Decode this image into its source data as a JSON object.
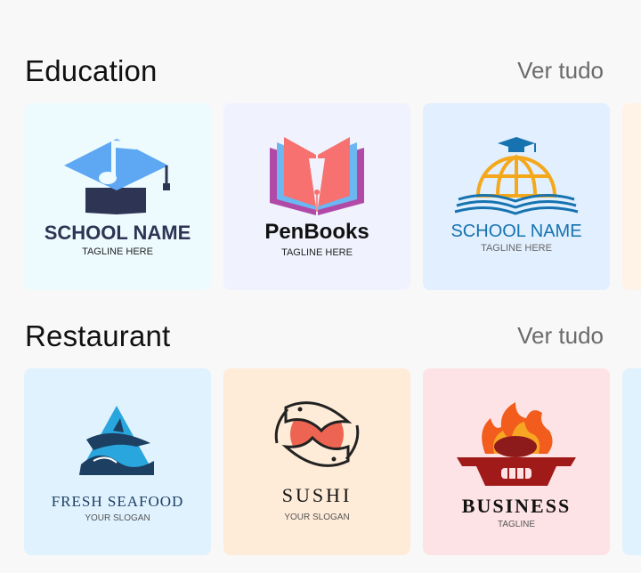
{
  "sections": [
    {
      "title": "Education",
      "see_all": "Ver tudo",
      "cards": [
        {
          "name": "SCHOOL NAME",
          "tagline": "TAGLINE HERE",
          "bg": "#eefbfe",
          "icon": "graduation-cap-note-icon"
        },
        {
          "name": "PenBooks",
          "tagline": "TAGLINE HERE",
          "bg": "#f0f2fe",
          "icon": "open-book-pen-icon"
        },
        {
          "name": "SCHOOL NAME",
          "tagline": "TAGLINE HERE",
          "bg": "#e1effe",
          "icon": "globe-book-cap-icon"
        }
      ]
    },
    {
      "title": "Restaurant",
      "see_all": "Ver tudo",
      "cards": [
        {
          "name": "FRESH SEAFOOD",
          "tagline": "YOUR SLOGAN",
          "bg": "#e0f2fe",
          "icon": "shark-wave-icon"
        },
        {
          "name": "SUSHI",
          "tagline": "YOUR SLOGAN",
          "bg": "#ffecd8",
          "icon": "koi-fish-icon"
        },
        {
          "name": "BUSINESS",
          "tagline": "TAGLINE",
          "bg": "#fde3e5",
          "icon": "grill-fire-icon"
        }
      ]
    }
  ],
  "colors": {
    "accent_blue": "#5ea8f3",
    "navy": "#2d3454",
    "school_blue": "#1673b0",
    "coral": "#f6716f",
    "orange": "#f49d1b",
    "dark_red": "#a11a1a"
  }
}
